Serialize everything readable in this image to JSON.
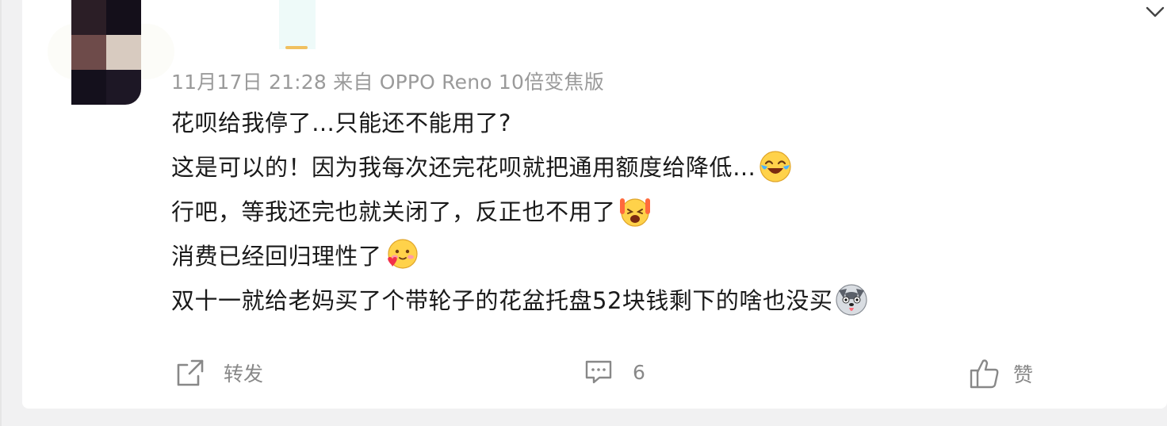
{
  "post": {
    "meta": "11月17日 21:28  来自 OPPO Reno 10倍变焦版",
    "lines": [
      {
        "text": "花呗给我停了…只能还不能用了?",
        "emoji": ""
      },
      {
        "text": "这是可以的！因为我每次还完花呗就把通用额度给降低…",
        "emoji": "laughing-crying-emoji"
      },
      {
        "text": "行吧，等我还完也就关闭了，反正也不用了",
        "emoji": "cheering-emoji"
      },
      {
        "text": "消费已经回归理性了",
        "emoji": "heart-cheeks-emoji"
      },
      {
        "text": "双十一就给老妈买了个带轮子的花盆托盘52块钱剩下的啥也没买",
        "emoji": "husky-emoji"
      }
    ]
  },
  "actions": {
    "repost_label": "转发",
    "comment_count": "6",
    "like_label": "赞"
  },
  "icons": {
    "repost": "share-arrow-icon",
    "comment": "comment-bubble-icon",
    "like": "thumbs-up-icon",
    "menu": "chevron-down-icon"
  },
  "colors": {
    "text": "#1a1a1a",
    "meta": "#9a9a9a",
    "action": "#888888",
    "background": "#f1f1f2"
  }
}
